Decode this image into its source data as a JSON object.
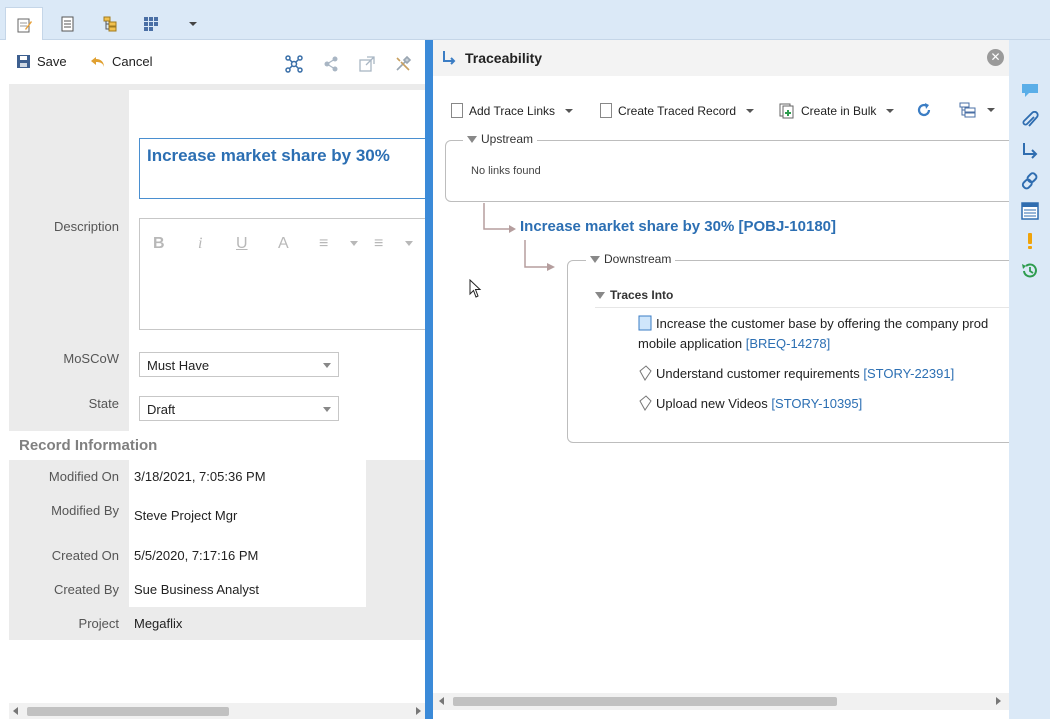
{
  "toolbar": {
    "save_label": "Save",
    "cancel_label": "Cancel"
  },
  "form": {
    "name_value": "Increase market share by 30%",
    "description_label": "Description",
    "moscow_label": "MoSCoW",
    "moscow_value": "Must Have",
    "state_label": "State",
    "state_value": "Draft",
    "rte_buttons": [
      "B",
      "i",
      "U",
      "A",
      "≡",
      "≡"
    ]
  },
  "record_info": {
    "title": "Record Information",
    "modified_on_label": "Modified On",
    "modified_on_value": "3/18/2021, 7:05:36 PM",
    "modified_by_label": "Modified By",
    "modified_by_value": "Steve Project Mgr",
    "created_on_label": "Created On",
    "created_on_value": "5/5/2020, 7:17:16 PM",
    "created_by_label": "Created By",
    "created_by_value": "Sue Business Analyst",
    "project_label": "Project",
    "project_value": "Megaflix"
  },
  "trace": {
    "title": "Traceability",
    "add_trace_links": "Add Trace Links",
    "create_traced_record": "Create Traced Record",
    "create_in_bulk": "Create in Bulk",
    "upstream_label": "Upstream",
    "no_links": "No links found",
    "root_item": "Increase market share by 30% [POBJ-10180]",
    "downstream_label": "Downstream",
    "traces_into_label": "Traces Into",
    "items": [
      {
        "text_line1": "Increase the customer base by offering the company prod",
        "text_line2": "mobile application",
        "id": "[BREQ-14278]"
      },
      {
        "text": "Understand customer requirements",
        "id": "[STORY-22391]"
      },
      {
        "text": "Upload new Videos",
        "id": "[STORY-10395]"
      }
    ]
  },
  "colors": {
    "accent": "#3b8ad8",
    "link": "#2c6fb3",
    "rail": "#dbe9f7",
    "history_green": "#2e9c4e",
    "alert_orange": "#f0a30a"
  },
  "icons": {
    "tabs": [
      "edit-record-icon",
      "document-icon",
      "tree-icon",
      "grid-icon",
      "chevron-down-icon"
    ],
    "rail": [
      "comment-icon",
      "attachment-icon",
      "trace-arrow-icon",
      "link-icon",
      "table-icon",
      "alert-icon",
      "history-icon"
    ]
  }
}
